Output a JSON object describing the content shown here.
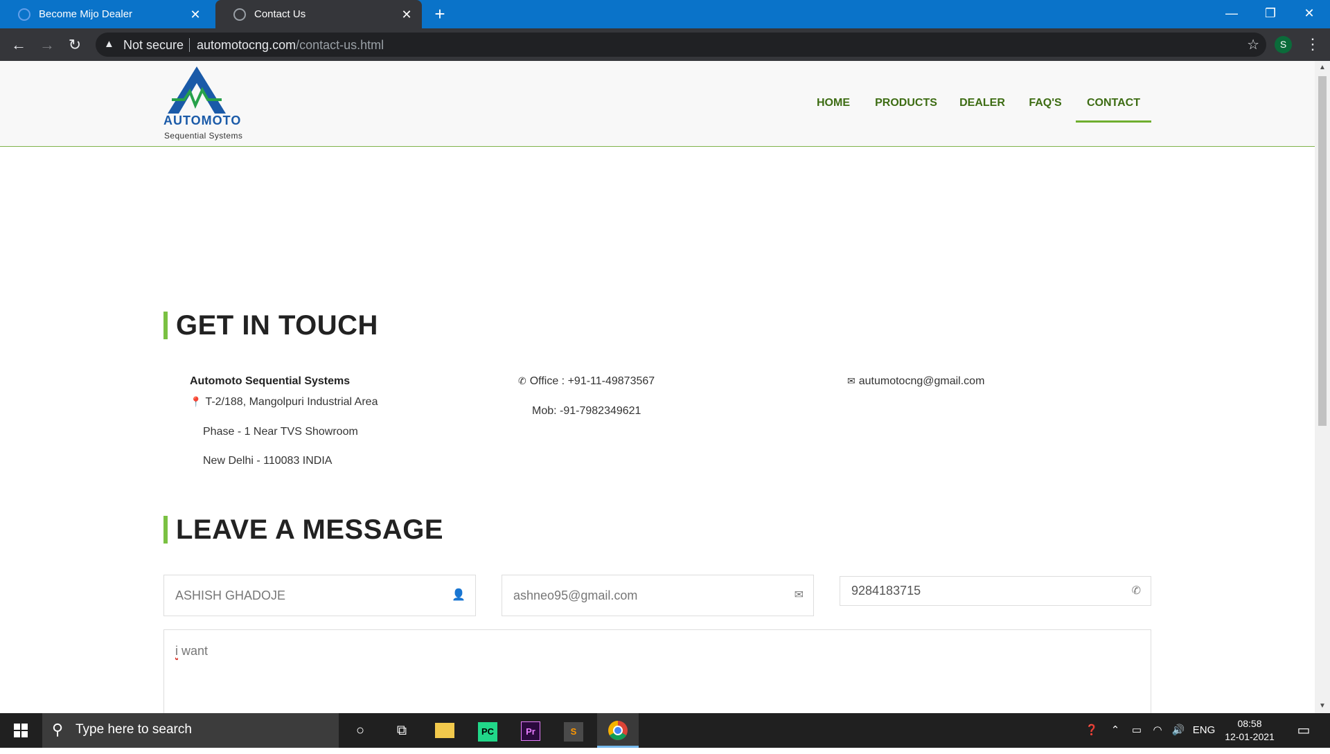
{
  "browser": {
    "tabs": [
      {
        "title": "Become Mijo Dealer",
        "active": false
      },
      {
        "title": "Contact Us",
        "active": true
      }
    ],
    "security_label": "Not secure",
    "url_host": "automotocng.com",
    "url_path": "/contact-us.html",
    "profile_initial": "S"
  },
  "site": {
    "logo_brand": "AUTOMOTO",
    "logo_sub": "Sequential Systems",
    "nav": [
      "HOME",
      "PRODUCTS",
      "DEALER",
      "FAQ'S",
      "CONTACT"
    ],
    "active_nav": "CONTACT",
    "accent_color": "#7ac142",
    "nav_color": "#3d6c13"
  },
  "contact": {
    "title": "GET IN TOUCH",
    "company": "Automoto Sequential Systems",
    "address_line1": "T-2/188, Mangolpuri Industrial Area",
    "address_line2": "Phase - 1 Near TVS Showroom",
    "address_line3": "New Delhi - 110083 INDIA",
    "office_phone": "Office : +91-11-49873567",
    "mobile": "Mob: -91-7982349621",
    "email": "autumotocng@gmail.com"
  },
  "message_form": {
    "title": "LEAVE A MESSAGE",
    "name_value": "ASHISH GHADOJE",
    "email_value": "ashneo95@gmail.com",
    "phone_value": "9284183715",
    "message_first_word": "i",
    "message_rest": " want"
  },
  "taskbar": {
    "search_placeholder": "Type here to search",
    "language": "ENG",
    "time": "08:58",
    "date": "12-01-2021"
  }
}
